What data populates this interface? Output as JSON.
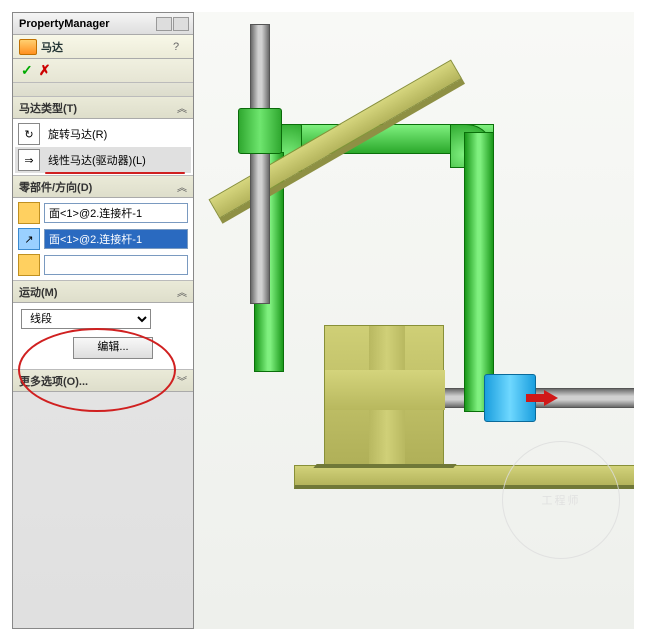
{
  "title": "PropertyManager",
  "feature": {
    "name": "马达",
    "pin_glyph": "?"
  },
  "confirm": {
    "ok_glyph": "✓",
    "cancel_glyph": "✗"
  },
  "groups": {
    "motor_type": {
      "header": "马达类型(T)",
      "rotary": {
        "icon": "↻",
        "label": "旋转马达(R)"
      },
      "linear": {
        "icon": "⇒",
        "label": "线性马达(驱动器)(L)"
      }
    },
    "component_dir": {
      "header": "零部件/方向(D)",
      "field1": "面<1>@2.连接杆-1",
      "field2_icon": "↗",
      "field2": "面<1>@2.连接杆-1",
      "field3": ""
    },
    "motion": {
      "header": "运动(M)",
      "select_value": "线段",
      "edit_btn": "编辑..."
    },
    "more": {
      "header": "更多选项(O)..."
    }
  },
  "icons": {
    "chev_up": "︽",
    "chev_down": "︾"
  },
  "watermark_text": "工程师"
}
